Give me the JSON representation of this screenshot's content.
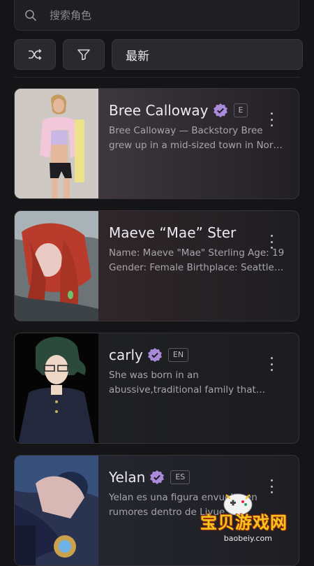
{
  "search": {
    "placeholder": "搜索角色"
  },
  "toolbar": {
    "sort_label": "最新"
  },
  "cards": [
    {
      "name": "Bree Calloway",
      "verified": true,
      "lang": "E",
      "description": "Bree Calloway — Backstory Bree grew up in a mid-sized town in Nor…",
      "avatar": "blonde-woman-photo"
    },
    {
      "name": "Maeve “Mae” Ster",
      "verified": false,
      "lang": "",
      "description": "Name: Maeve \"Mae\" Sterling Age: 19 Gender: Female Birthplace: Seattle…",
      "avatar": "red-haired-anime-girl"
    },
    {
      "name": "carly",
      "verified": true,
      "lang": "EN",
      "description": "She was born in an abussive,traditional family that…",
      "avatar": "green-haired-anime-girl-glasses"
    },
    {
      "name": "Yelan",
      "verified": true,
      "lang": "ES",
      "description": "Yelan es una figura envuelta en rumores dentro de Liyue…",
      "avatar": "blue-haired-anime-character"
    }
  ],
  "watermark": {
    "title": "宝贝游戏网",
    "url": "baobeiy.com"
  },
  "colors": {
    "accent_verified": "#a98bd9",
    "card_bg": "#1c1b1f",
    "page_bg": "#151417"
  }
}
